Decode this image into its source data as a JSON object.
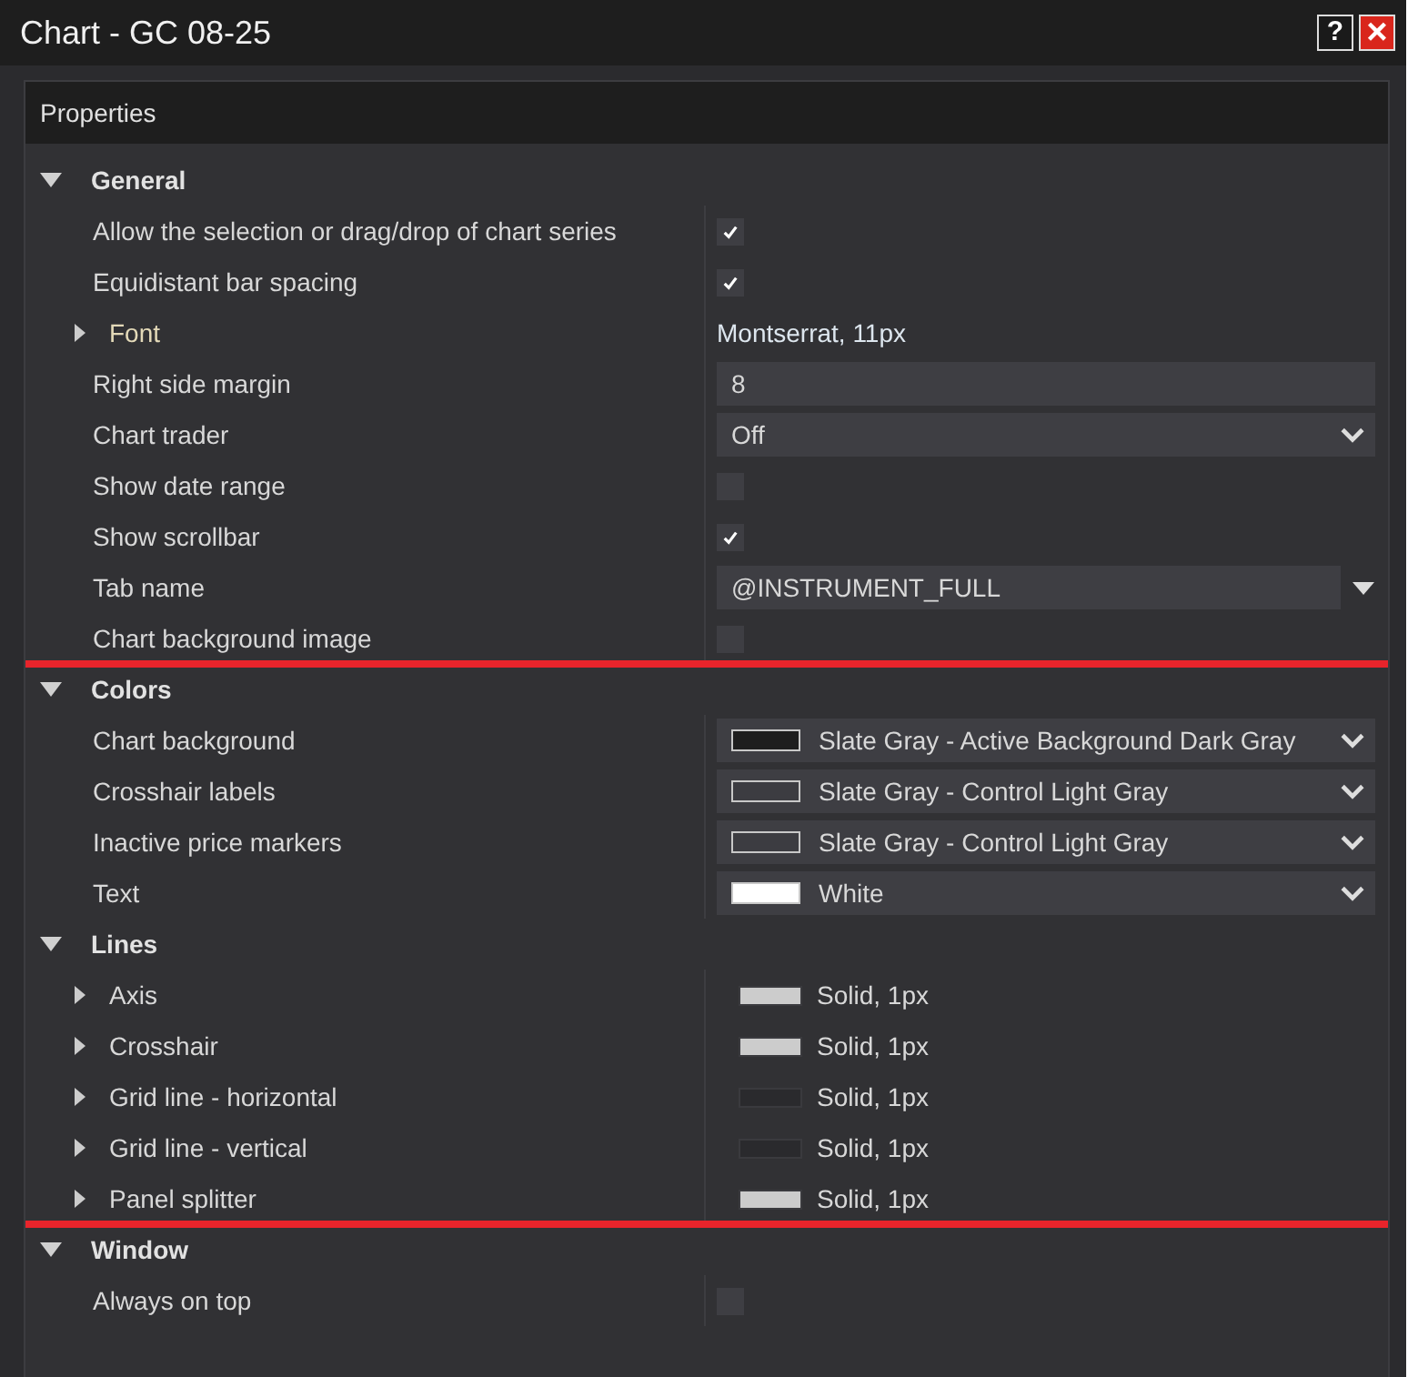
{
  "window": {
    "title": "Chart - GC 08-25"
  },
  "title_buttons": [
    {
      "kind": "help",
      "label": "?"
    },
    {
      "kind": "close",
      "label": "×"
    }
  ],
  "panel": {
    "title": "Properties"
  },
  "sections": [
    {
      "title": "General",
      "expanded": true,
      "highlighted": false,
      "rows": [
        {
          "kind": "checkbox",
          "label": "Allow the selection or drag/drop of chart series",
          "checked": true
        },
        {
          "kind": "checkbox",
          "label": "Equidistant bar spacing",
          "checked": true
        },
        {
          "kind": "expandable",
          "label": "Font",
          "expanded": false,
          "value": "Montserrat, 11px"
        },
        {
          "kind": "input",
          "label": "Right side margin",
          "value": "8"
        },
        {
          "kind": "select",
          "label": "Chart trader",
          "value": "Off"
        },
        {
          "kind": "checkbox",
          "label": "Show date range",
          "checked": false
        },
        {
          "kind": "checkbox",
          "label": "Show scrollbar",
          "checked": true
        },
        {
          "kind": "combo",
          "label": "Tab name",
          "value": "@INSTRUMENT_FULL"
        },
        {
          "kind": "checkbox",
          "label": "Chart background image",
          "checked": false
        }
      ]
    },
    {
      "title": "Colors",
      "expanded": true,
      "highlighted": true,
      "rows": [
        {
          "kind": "color",
          "label": "Chart background",
          "value": "Slate Gray - Active Background Dark Gray",
          "color": "#1e1e1e"
        },
        {
          "kind": "color",
          "label": "Crosshair labels",
          "value": "Slate Gray - Control Light Gray",
          "color": "#3c3c41"
        },
        {
          "kind": "color",
          "label": "Inactive price markers",
          "value": "Slate Gray - Control Light Gray",
          "color": "#3c3c41"
        },
        {
          "kind": "color",
          "label": "Text",
          "value": "White",
          "color": "#ffffff"
        }
      ]
    },
    {
      "title": "Lines",
      "expanded": true,
      "highlighted": true,
      "rows": [
        {
          "kind": "stroke",
          "label": "Axis",
          "expanded": false,
          "value": "Solid, 1px",
          "color": "#cccccc"
        },
        {
          "kind": "stroke",
          "label": "Crosshair",
          "expanded": false,
          "value": "Solid, 1px",
          "color": "#cccccc"
        },
        {
          "kind": "stroke",
          "label": "Grid line - horizontal",
          "expanded": false,
          "value": "Solid, 1px",
          "color": "#2a2a2d"
        },
        {
          "kind": "stroke",
          "label": "Grid line - vertical",
          "expanded": false,
          "value": "Solid, 1px",
          "color": "#2a2a2d"
        },
        {
          "kind": "stroke",
          "label": "Panel splitter",
          "expanded": false,
          "value": "Solid, 1px",
          "color": "#cccccc"
        }
      ]
    },
    {
      "title": "Window",
      "expanded": true,
      "highlighted": false,
      "rows": [
        {
          "kind": "checkbox",
          "label": "Always on top",
          "checked": false
        }
      ]
    }
  ]
}
